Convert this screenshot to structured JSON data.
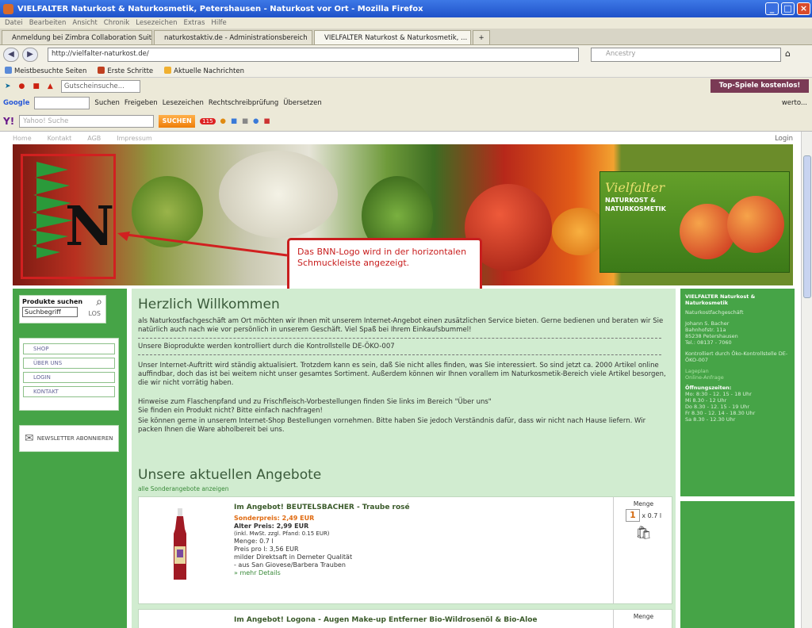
{
  "window": {
    "title": "VIELFALTER Naturkost & Naturkosmetik, Petershausen - Naturkost vor Ort - Mozilla Firefox"
  },
  "menu": [
    "Datei",
    "Bearbeiten",
    "Ansicht",
    "Chronik",
    "Lesezeichen",
    "Extras",
    "Hilfe"
  ],
  "tabs": [
    {
      "label": "Anmeldung bei Zimbra Collaboration Suite"
    },
    {
      "label": "naturkostaktiv.de - Administrationsbereich"
    },
    {
      "label": "VIELFALTER Naturkost & Naturkosmetik, ..."
    }
  ],
  "nav": {
    "url": "http://vielfalter-naturkost.de/",
    "search_placeholder": "Ancestry"
  },
  "bookmarks": [
    "Meistbesuchte Seiten",
    "Erste Schritte",
    "Aktuelle Nachrichten"
  ],
  "toolbar1": {
    "gutscheine": "Gutscheinsuche...",
    "topspiele": "Top-Spiele kostenlos!"
  },
  "toolbar2": {
    "google": "Google",
    "suchen": "Suchen",
    "freigeben": "Freigeben",
    "lesezeichen": "Lesezeichen",
    "rechtschreibung": "Rechtschreibprüfung",
    "uebersetzen": "Übersetzen",
    "wertvoll": "werto..."
  },
  "toolbar3": {
    "search_placeholder": "Yahoo! Suche",
    "suchen_btn": "SUCHEN",
    "badge": "115"
  },
  "site": {
    "nav": [
      "Home",
      "Kontakt",
      "AGB",
      "Impressum"
    ],
    "login": "Login",
    "callout": "Das BNN-Logo wird in der horizontalen Schmuckleiste angezeigt.",
    "brand_name": "Vielfalter",
    "brand_tag": "NATURKOST & NATURKOSMETIK",
    "search": {
      "title": "Produkte suchen",
      "placeholder": "Suchbegriff",
      "los": "LOS"
    },
    "menu": [
      "SHOP",
      "ÜBER UNS",
      "LOGIN",
      "KONTAKT"
    ],
    "newsletter": "NEWSLETTER ABONNIEREN",
    "welcome": "Herzlich Willkommen",
    "p1": "als Naturkostfachgeschäft am Ort möchten wir Ihnen mit unserem Internet-Angebot einen zusätzlichen Service bieten. Gerne bedienen und beraten wir Sie natürlich auch nach wie vor persönlich in unserem Geschäft. Viel Spaß bei Ihrem Einkaufsbummel!",
    "p2": "Unsere Bioprodukte werden kontrolliert durch die Kontrollstelle DE-ÖKO-007",
    "p3": "Unser Internet-Auftritt wird ständig aktualisiert. Trotzdem kann es sein, daß Sie nicht alles finden, was Sie interessiert. So sind jetzt ca. 2000 Artikel online auffindbar, doch das ist bei weitem nicht unser gesamtes Sortiment. Außerdem können wir Ihnen vorallem im Naturkosmetik-Bereich viele Artikel besorgen, die wir nicht vorrätig haben.",
    "p4": "Hinweise zum Flaschenpfand und zu Frischfleisch-Vorbestellungen finden Sie links im Bereich \"Über uns\"",
    "p5": "Sie finden ein Produkt nicht? Bitte einfach nachfragen!",
    "p6": "Sie können gerne in unserem Internet-Shop Bestellungen vornehmen. Bitte haben Sie jedoch Verständnis dafür, dass wir nicht nach Hause liefern. Wir packen Ihnen die Ware abholbereit bei uns.",
    "offers_title": "Unsere aktuellen Angebote",
    "offers_link": "alle Sonderangebote anzeigen",
    "products": [
      {
        "title": "Im Angebot!  BEUTELSBACHER - Traube rosé",
        "special": "Sonderpreis: 2,49 EUR",
        "old": "Alter Preis: 2,99 EUR",
        "mwst": "(inkl. MwSt. zzgl. Pfand: 0.15 EUR)",
        "menge": "Menge: 0.7 l",
        "preis_pro": "Preis pro l: 3,56 EUR",
        "desc1": "milder Direktsaft in Demeter Qualität",
        "desc2": "- aus San Giovese/Barbera Trauben",
        "more": "» mehr Details",
        "menge_label": "Menge",
        "qty": "1",
        "unit": "x 0.7 l"
      },
      {
        "title": "Im Angebot!  Logona - Augen Make-up Entferner Bio-Wildrosenöl & Bio-Aloe",
        "menge_label": "Menge"
      }
    ],
    "right": {
      "shop": "VIELFALTER Naturkost & Naturkosmetik",
      "fach": "Naturkostfachgeschäft",
      "addr1": "Johann S. Bacher",
      "addr2": "Bahnhofstr. 11a",
      "addr3": "85238 Petershausen",
      "tel": "Tel.: 08137 - 7060",
      "kontrolle": "Kontrolliert durch Öko-Kontrollstelle DE-ÖKO-007",
      "lageplan": "Lageplan",
      "verkehr": "Online-Anfrage",
      "hours_title": "Öffnungszeiten:",
      "h1": "Mo: 8:30 - 12. 15 - 18 Uhr",
      "h2": "Mi 8.30 - 12 Uhr",
      "h3": "Do 8.30 - 12. 15 - 19 Uhr",
      "h4": "Fr 8.30 - 12. 14 - 18.30 Uhr",
      "h5": "Sa 8.30 - 12.30 Uhr"
    }
  }
}
